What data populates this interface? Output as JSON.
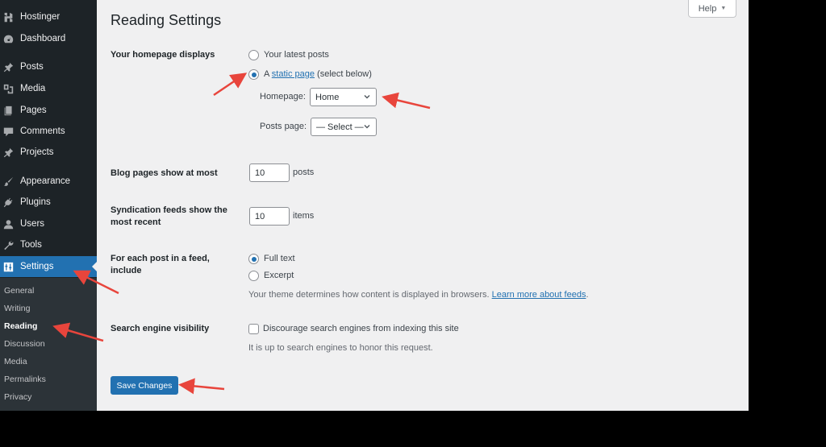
{
  "sidebar": {
    "items": [
      {
        "label": "Hostinger",
        "icon": "hostinger-logo-icon"
      },
      {
        "label": "Dashboard",
        "icon": "dashboard-gauge-icon"
      },
      {
        "label": "Posts",
        "icon": "pushpin-icon"
      },
      {
        "label": "Media",
        "icon": "media-icon"
      },
      {
        "label": "Pages",
        "icon": "pages-icon"
      },
      {
        "label": "Comments",
        "icon": "comment-bubble-icon"
      },
      {
        "label": "Projects",
        "icon": "pushpin-icon"
      },
      {
        "label": "Appearance",
        "icon": "paintbrush-icon"
      },
      {
        "label": "Plugins",
        "icon": "plug-icon"
      },
      {
        "label": "Users",
        "icon": "user-icon"
      },
      {
        "label": "Tools",
        "icon": "wrench-icon"
      },
      {
        "label": "Settings",
        "icon": "settings-sliders-icon",
        "active": true
      }
    ],
    "submenu": [
      {
        "label": "General"
      },
      {
        "label": "Writing"
      },
      {
        "label": "Reading",
        "current": true
      },
      {
        "label": "Discussion"
      },
      {
        "label": "Media"
      },
      {
        "label": "Permalinks"
      },
      {
        "label": "Privacy"
      }
    ]
  },
  "header": {
    "title": "Reading Settings",
    "help_label": "Help",
    "help_caret": "▼"
  },
  "settings": {
    "homepage_displays": {
      "label": "Your homepage displays",
      "options": [
        {
          "label": "Your latest posts",
          "checked": false
        },
        {
          "prefix": "A ",
          "link": "static page",
          "suffix": " (select below)",
          "checked": true
        }
      ],
      "homepage_label": "Homepage:",
      "homepage_value": "Home",
      "posts_page_label": "Posts page:",
      "posts_page_value": "— Select —"
    },
    "blog_pages": {
      "label": "Blog pages show at most",
      "value": "10",
      "unit": "posts"
    },
    "syndication": {
      "label_line1": "Syndication feeds show the",
      "label_line2": "most recent",
      "value": "10",
      "unit": "items"
    },
    "feed_content": {
      "label_line1": "For each post in a feed,",
      "label_line2": "include",
      "options": [
        {
          "label": "Full text",
          "checked": true
        },
        {
          "label": "Excerpt",
          "checked": false
        }
      ],
      "description": "Your theme determines how content is displayed in browsers. ",
      "description_link": "Learn more about feeds",
      "description_end": "."
    },
    "search_visibility": {
      "label": "Search engine visibility",
      "checkbox_label": "Discourage search engines from indexing this site",
      "checked": false,
      "description": "It is up to search engines to honor this request."
    }
  },
  "footer": {
    "save_label": "Save Changes"
  },
  "colors": {
    "accent": "#2271b1",
    "sidebar_bg": "#1d2327",
    "submenu_bg": "#2c3338",
    "content_bg": "#f0f0f1",
    "annotation_arrow": "#e8453c"
  }
}
